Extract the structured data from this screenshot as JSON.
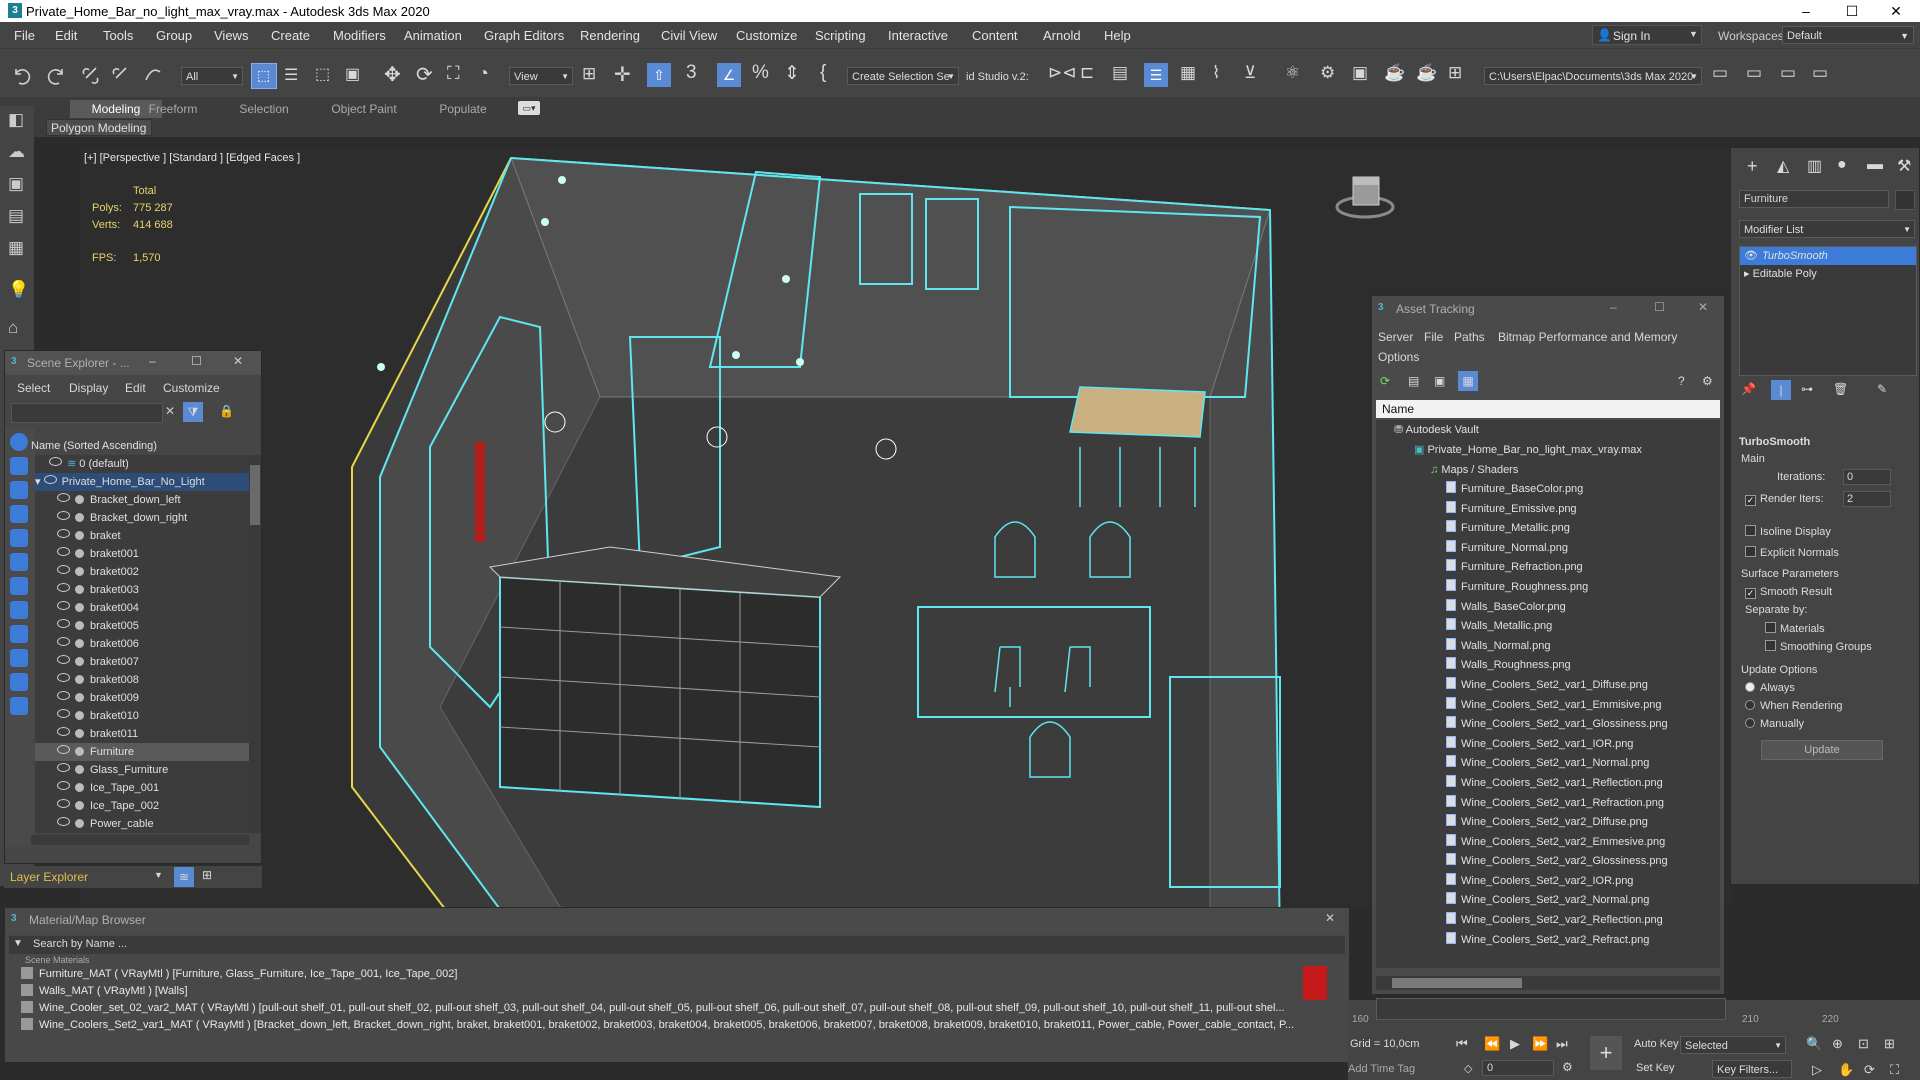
{
  "window": {
    "title": "Private_Home_Bar_no_light_max_vray.max - Autodesk 3ds Max 2020",
    "minimize": "–",
    "maximize": "☐",
    "close": "✕"
  },
  "menubar": {
    "items": [
      "File",
      "Edit",
      "Tools",
      "Group",
      "Views",
      "Create",
      "Modifiers",
      "Animation",
      "Graph Editors",
      "Rendering",
      "Civil View",
      "Customize",
      "Scripting",
      "Interactive",
      "Content",
      "Arnold",
      "Help"
    ],
    "signin": "Sign In",
    "workspaces_label": "Workspaces:",
    "workspaces_value": "Default"
  },
  "toolbar": {
    "filter": "All",
    "ref_coord": "View",
    "selection_set": "Create Selection Se",
    "studio": "id Studio v.2:",
    "path": "C:\\Users\\Elpac\\Documents\\3ds Max 2020"
  },
  "ribbon": {
    "tabs": [
      "Modeling",
      "Freeform",
      "Selection",
      "Object Paint",
      "Populate"
    ],
    "active_tab": "Modeling",
    "sub": "Polygon Modeling"
  },
  "viewport": {
    "label": "[+] [Perspective ] [Standard ] [Edged Faces ]",
    "stats": {
      "total_label": "Total",
      "polys_label": "Polys:",
      "polys": "775 287",
      "verts_label": "Verts:",
      "verts": "414 688",
      "fps_label": "FPS:",
      "fps": "1,570"
    }
  },
  "scene_explorer": {
    "title": "Scene Explorer - ...",
    "menu": [
      "Select",
      "Display",
      "Edit",
      "Customize"
    ],
    "column": "Name (Sorted Ascending)",
    "default_layer": "0 (default)",
    "root": "Private_Home_Bar_No_Light",
    "items": [
      "Bracket_down_left",
      "Bracket_down_right",
      "braket",
      "braket001",
      "braket002",
      "braket003",
      "braket004",
      "braket005",
      "braket006",
      "braket007",
      "braket008",
      "braket009",
      "braket010",
      "braket011",
      "Furniture",
      "Glass_Furniture",
      "Ice_Tape_001",
      "Ice_Tape_002",
      "Power_cable"
    ],
    "selected": "Furniture",
    "footer": "Layer Explorer"
  },
  "asset_tracking": {
    "title": "Asset Tracking",
    "menu": [
      "Server",
      "File",
      "Paths",
      "Bitmap Performance and Memory"
    ],
    "menu2": "Options",
    "column": "Name",
    "vault": "Autodesk Vault",
    "scene_file": "Private_Home_Bar_no_light_max_vray.max",
    "maps_folder": "Maps / Shaders",
    "files": [
      "Furniture_BaseColor.png",
      "Furniture_Emissive.png",
      "Furniture_Metallic.png",
      "Furniture_Normal.png",
      "Furniture_Refraction.png",
      "Furniture_Roughness.png",
      "Walls_BaseColor.png",
      "Walls_Metallic.png",
      "Walls_Normal.png",
      "Walls_Roughness.png",
      "Wine_Coolers_Set2_var1_Diffuse.png",
      "Wine_Coolers_Set2_var1_Emmisive.png",
      "Wine_Coolers_Set2_var1_Glossiness.png",
      "Wine_Coolers_Set2_var1_IOR.png",
      "Wine_Coolers_Set2_var1_Normal.png",
      "Wine_Coolers_Set2_var1_Reflection.png",
      "Wine_Coolers_Set2_var1_Refraction.png",
      "Wine_Coolers_Set2_var2_Diffuse.png",
      "Wine_Coolers_Set2_var2_Emmesive.png",
      "Wine_Coolers_Set2_var2_Glossiness.png",
      "Wine_Coolers_Set2_var2_IOR.png",
      "Wine_Coolers_Set2_var2_Normal.png",
      "Wine_Coolers_Set2_var2_Reflection.png",
      "Wine_Coolers_Set2_var2_Refract.png"
    ]
  },
  "command_panel": {
    "object_name": "Furniture",
    "modifier_list": "Modifier List",
    "stack": [
      "TurboSmooth",
      "Editable Poly"
    ],
    "rollout_title": "TurboSmooth",
    "main_label": "Main",
    "iterations_label": "Iterations:",
    "iterations": "0",
    "render_iters_label": "Render Iters:",
    "render_iters": "2",
    "isoline": "Isoline Display",
    "explicit_normals": "Explicit Normals",
    "surface_params": "Surface Parameters",
    "smooth_result": "Smooth Result",
    "separate_by": "Separate by:",
    "materials": "Materials",
    "smoothing_groups": "Smoothing Groups",
    "update_options": "Update Options",
    "always": "Always",
    "when_rendering": "When Rendering",
    "manually": "Manually",
    "update_btn": "Update"
  },
  "material_browser": {
    "title": "Material/Map Browser",
    "search": "Search by Name ...",
    "section": "Scene Materials",
    "rows": [
      "Furniture_MAT ( VRayMtl ) [Furniture, Glass_Furniture, Ice_Tape_001, Ice_Tape_002]",
      "Walls_MAT ( VRayMtl ) [Walls]",
      "Wine_Cooler_set_02_var2_MAT ( VRayMtl ) [pull-out shelf_01, pull-out shelf_02, pull-out shelf_03, pull-out shelf_04, pull-out shelf_05, pull-out shelf_06, pull-out shelf_07, pull-out shelf_08, pull-out shelf_09, pull-out shelf_10, pull-out shelf_11, pull-out shel...",
      "Wine_Coolers_Set2_var1_MAT ( VRayMtl ) [Bracket_down_left, Bracket_down_right, braket, braket001, braket002, braket003, braket004, braket005, braket006, braket007, braket008, braket009, braket010, braket011, Power_cable, Power_cable_contact, P..."
    ]
  },
  "timeline": {
    "tick_160": "160",
    "tick_210": "210",
    "tick_220": "220"
  },
  "statusbar": {
    "grid": "Grid = 10,0cm",
    "add_time_tag": "Add Time Tag",
    "frame": "0",
    "auto_key": "Auto Key",
    "set_key": "Set Key",
    "selected": "Selected",
    "key_filters": "Key Filters..."
  },
  "colors": {
    "ui_bg": "#444444",
    "viewport_bg": "#2d2d2d",
    "selection_cyan": "#5fe6f0",
    "bbox_yellow": "#e6d64a",
    "accent_blue": "#3d7bd9"
  }
}
